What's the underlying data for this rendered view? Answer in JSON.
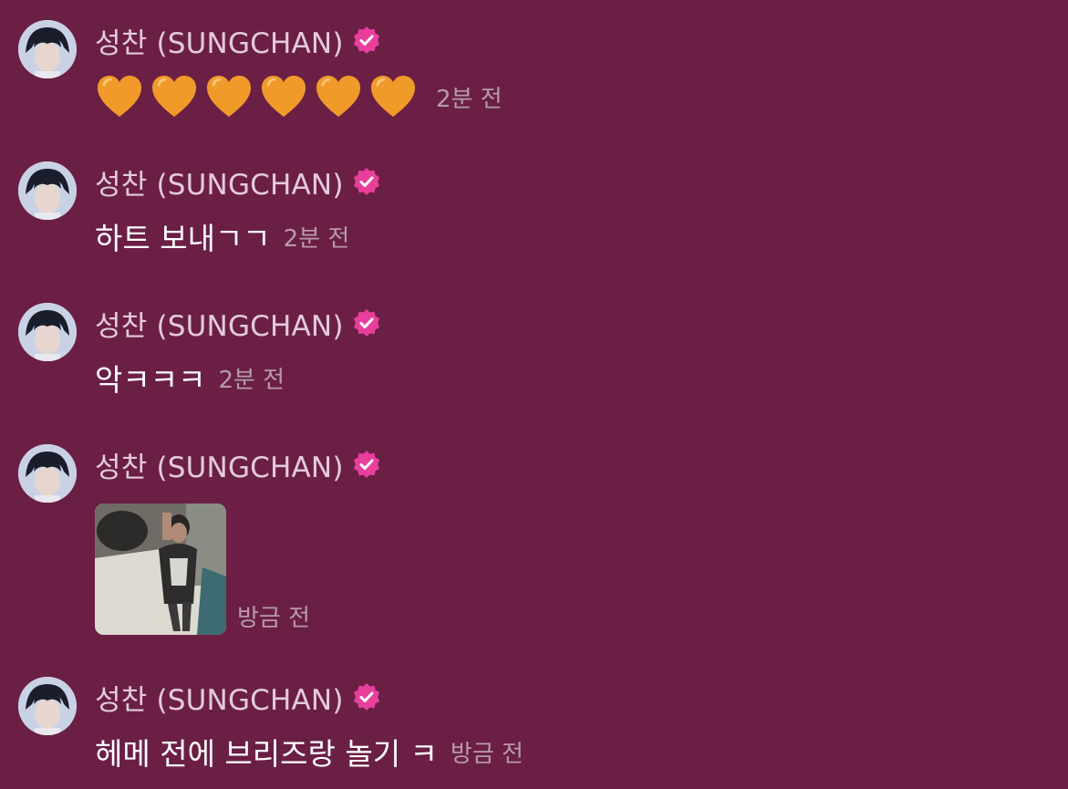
{
  "colors": {
    "background": "#6b1f45",
    "name": "#e4cbd8",
    "message_text": "#ffffff",
    "timestamp": "#b79aac",
    "verified_badge": "#e8409a",
    "heart": "#f09a2a"
  },
  "messages": [
    {
      "author": "성찬 (SUNGCHAN)",
      "verified_icon": "verified-badge-icon",
      "content_type": "emoji",
      "emoji": "orange-heart-icon",
      "emoji_count": 6,
      "time": "2분 전"
    },
    {
      "author": "성찬 (SUNGCHAN)",
      "verified_icon": "verified-badge-icon",
      "content_type": "text",
      "text": "하트 보내ㄱㄱ",
      "time": "2분 전"
    },
    {
      "author": "성찬 (SUNGCHAN)",
      "verified_icon": "verified-badge-icon",
      "content_type": "text",
      "text": "악ㅋㅋㅋ",
      "time": "2분 전"
    },
    {
      "author": "성찬 (SUNGCHAN)",
      "verified_icon": "verified-badge-icon",
      "content_type": "image",
      "image": "photo-thumbnail",
      "time": "방금 전"
    },
    {
      "author": "성찬 (SUNGCHAN)",
      "verified_icon": "verified-badge-icon",
      "content_type": "text",
      "text": "헤메 전에 브리즈랑 놀기 ㅋ",
      "time": "방금 전"
    }
  ]
}
